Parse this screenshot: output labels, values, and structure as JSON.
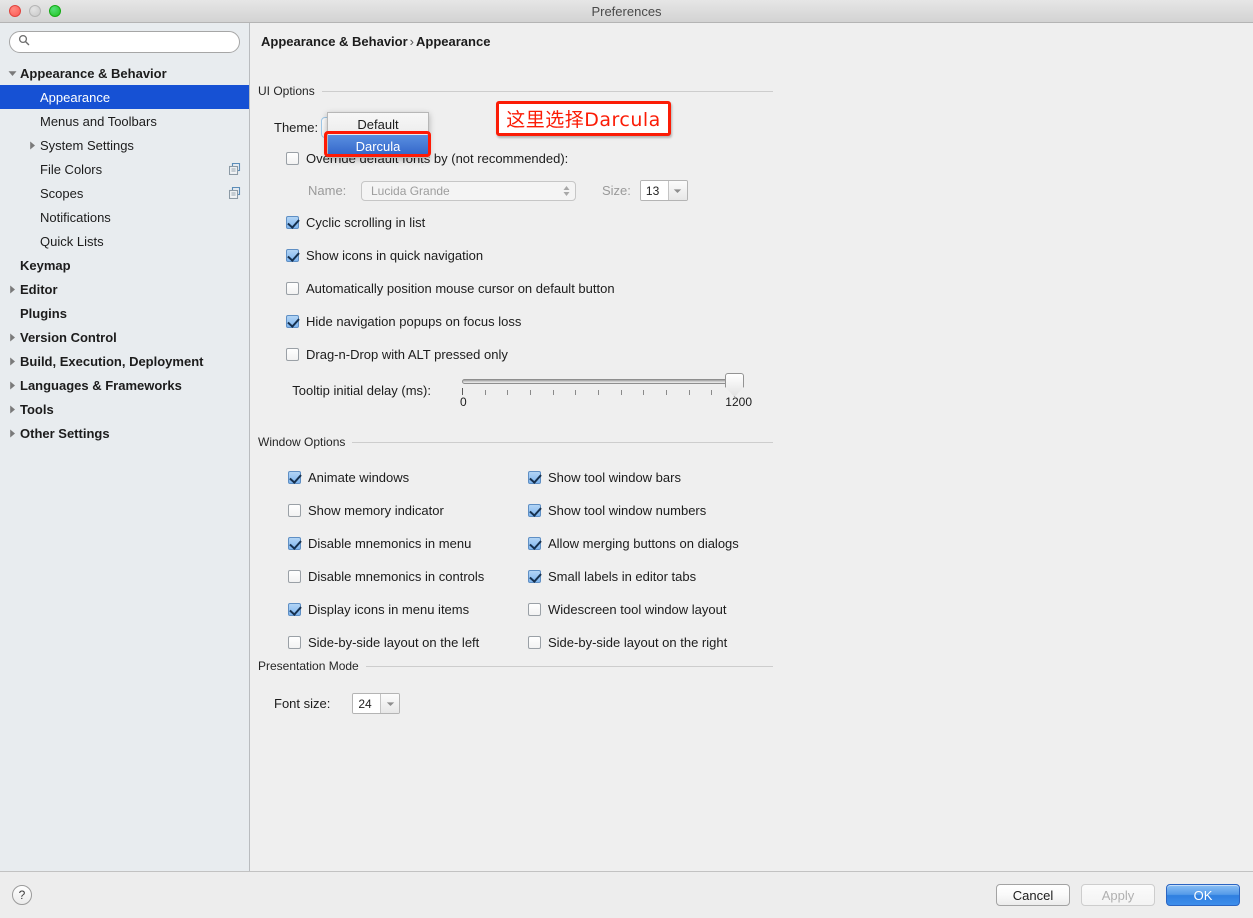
{
  "window": {
    "title": "Preferences",
    "traffic_lights": [
      "close-button",
      "minimize-button",
      "zoom-button"
    ]
  },
  "search": {
    "value": "",
    "placeholder": ""
  },
  "sidebar": {
    "items": [
      {
        "label": "Appearance & Behavior",
        "level": 0,
        "twisty": "down",
        "bold": true,
        "selected": false,
        "badge": null
      },
      {
        "label": "Appearance",
        "level": 1,
        "twisty": "none",
        "bold": false,
        "selected": true,
        "badge": null
      },
      {
        "label": "Menus and Toolbars",
        "level": 1,
        "twisty": "none",
        "bold": false,
        "selected": false,
        "badge": null
      },
      {
        "label": "System Settings",
        "level": 1,
        "twisty": "right",
        "bold": false,
        "selected": false,
        "badge": null
      },
      {
        "label": "File Colors",
        "level": 1,
        "twisty": "none",
        "bold": false,
        "selected": false,
        "badge": "copy-icon"
      },
      {
        "label": "Scopes",
        "level": 1,
        "twisty": "none",
        "bold": false,
        "selected": false,
        "badge": "copy-icon"
      },
      {
        "label": "Notifications",
        "level": 1,
        "twisty": "none",
        "bold": false,
        "selected": false,
        "badge": null
      },
      {
        "label": "Quick Lists",
        "level": 1,
        "twisty": "none",
        "bold": false,
        "selected": false,
        "badge": null
      },
      {
        "label": "Keymap",
        "level": 0,
        "twisty": "none",
        "bold": true,
        "selected": false,
        "badge": null
      },
      {
        "label": "Editor",
        "level": 0,
        "twisty": "right",
        "bold": true,
        "selected": false,
        "badge": null
      },
      {
        "label": "Plugins",
        "level": 0,
        "twisty": "none",
        "bold": true,
        "selected": false,
        "badge": null
      },
      {
        "label": "Version Control",
        "level": 0,
        "twisty": "right",
        "bold": true,
        "selected": false,
        "badge": null
      },
      {
        "label": "Build, Execution, Deployment",
        "level": 0,
        "twisty": "right",
        "bold": true,
        "selected": false,
        "badge": null
      },
      {
        "label": "Languages & Frameworks",
        "level": 0,
        "twisty": "right",
        "bold": true,
        "selected": false,
        "badge": null
      },
      {
        "label": "Tools",
        "level": 0,
        "twisty": "right",
        "bold": true,
        "selected": false,
        "badge": null
      },
      {
        "label": "Other Settings",
        "level": 0,
        "twisty": "right",
        "bold": true,
        "selected": false,
        "badge": null
      }
    ]
  },
  "breadcrumb": {
    "root": "Appearance & Behavior",
    "sep": "›",
    "leaf": "Appearance"
  },
  "ui_options": {
    "group_title": "UI Options",
    "theme_label": "Theme:",
    "theme_options": [
      "Default",
      "Darcula"
    ],
    "theme_selected": "Darcula",
    "override_fonts": {
      "label": "Override default fonts by (not recommended):",
      "checked": false
    },
    "name_label": "Name:",
    "name_value": "Lucida Grande",
    "size_label": "Size:",
    "size_value": "13",
    "checkboxes": [
      {
        "label": "Cyclic scrolling in list",
        "checked": true
      },
      {
        "label": "Show icons in quick navigation",
        "checked": true
      },
      {
        "label": "Automatically position mouse cursor on default button",
        "checked": false
      },
      {
        "label": "Hide navigation popups on focus loss",
        "checked": true
      },
      {
        "label": "Drag-n-Drop with ALT pressed only",
        "checked": false
      }
    ],
    "tooltip": {
      "label": "Tooltip initial delay (ms):",
      "min_label": "0",
      "max_label": "1200",
      "min": 0,
      "max": 1200,
      "value": 1200,
      "tick_count": 13
    }
  },
  "window_options": {
    "group_title": "Window Options",
    "left_column": [
      {
        "label": "Animate windows",
        "checked": true
      },
      {
        "label": "Show memory indicator",
        "checked": false
      },
      {
        "label": "Disable mnemonics in menu",
        "checked": true
      },
      {
        "label": "Disable mnemonics in controls",
        "checked": false
      },
      {
        "label": "Display icons in menu items",
        "checked": true
      },
      {
        "label": "Side-by-side layout on the left",
        "checked": false
      }
    ],
    "right_column": [
      {
        "label": "Show tool window bars",
        "checked": true
      },
      {
        "label": "Show tool window numbers",
        "checked": true
      },
      {
        "label": "Allow merging buttons on dialogs",
        "checked": true
      },
      {
        "label": "Small labels in editor tabs",
        "checked": true
      },
      {
        "label": "Widescreen tool window layout",
        "checked": false
      },
      {
        "label": "Side-by-side layout on the right",
        "checked": false
      }
    ]
  },
  "presentation_mode": {
    "group_title": "Presentation Mode",
    "font_size_label": "Font size:",
    "font_size_value": "24"
  },
  "annotation": {
    "text": "这里选择Darcula",
    "color": "#fb1c06"
  },
  "footer": {
    "help": "?",
    "cancel": "Cancel",
    "apply": "Apply",
    "apply_disabled": true,
    "ok": "OK"
  },
  "colors": {
    "selection_blue": "#1651d4",
    "popup_selection_blue": "#2f62c8",
    "annotation_red": "#fb1c06",
    "window_bg": "#efefef",
    "sidebar_bg": "#e8ecef"
  }
}
